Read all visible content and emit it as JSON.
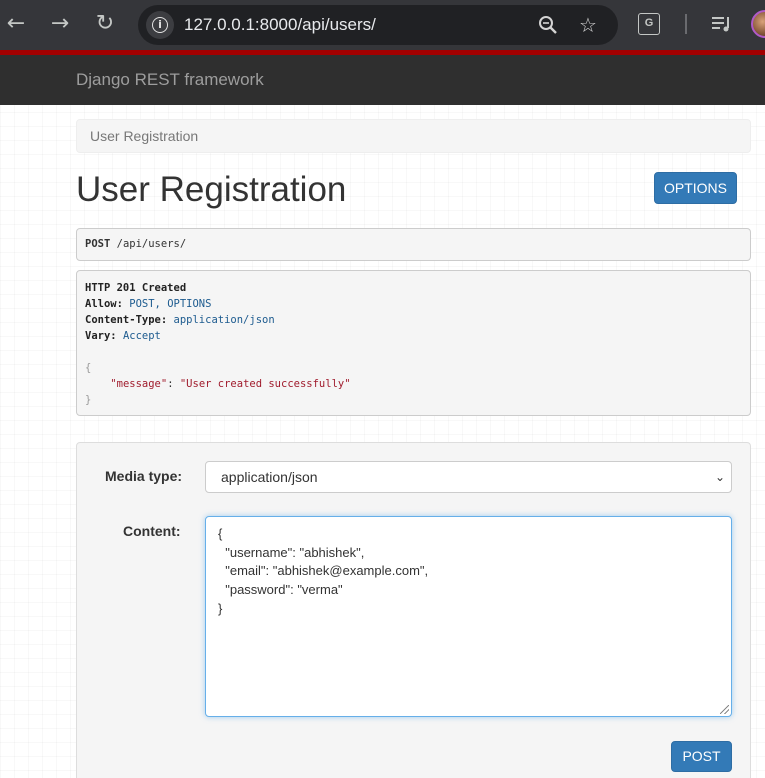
{
  "browser": {
    "url": "127.0.0.1:8000/api/users/",
    "icons": {
      "back": "arrow-left-icon",
      "forward": "arrow-right-icon",
      "reload": "reload-icon",
      "site_info": "info-icon",
      "zoom": "magnifier-icon",
      "bookmark": "star-icon",
      "translate": "translate-icon",
      "media": "playlist-icon",
      "profile": "avatar"
    }
  },
  "navbar": {
    "brand": "Django REST framework"
  },
  "breadcrumb": {
    "current": "User Registration"
  },
  "page": {
    "title": "User Registration",
    "options_label": "OPTIONS"
  },
  "request": {
    "method": "POST",
    "path": "/api/users/"
  },
  "response": {
    "status_line": "HTTP 201 Created",
    "headers": [
      {
        "name": "Allow:",
        "value": "POST, OPTIONS"
      },
      {
        "name": "Content-Type:",
        "value": "application/json"
      },
      {
        "name": "Vary:",
        "value": "Accept"
      }
    ],
    "body": {
      "open": "{",
      "key": "\"message\"",
      "colon": ": ",
      "value": "\"User created successfully\"",
      "close": "}"
    }
  },
  "form": {
    "media_type_label": "Media type:",
    "media_type_value": "application/json",
    "content_label": "Content:",
    "content_lines": [
      "{",
      "  \"username\": \"abhishek\",",
      "  \"email\": \"abhishek@example.com\",",
      "  \"password\": \"verma\"",
      "}"
    ],
    "submit_label": "POST"
  },
  "colors": {
    "primary": "#337ab7",
    "navbar": "#2f2f2f",
    "accent_strip": "#a30000",
    "string": "#a01b2c"
  }
}
